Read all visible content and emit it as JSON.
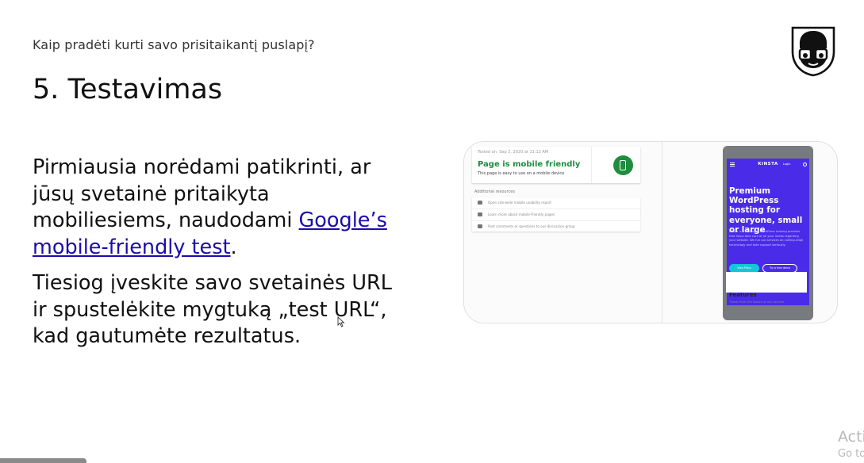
{
  "slide": {
    "subtitle": "Kaip pradėti kurti savo prisitaikantį puslapį?",
    "title": "5. Testavimas",
    "paragraph1_before_link": "Pirmiausia norėdami patikrinti, ar jūsų svetainė pritaikyta mobiliesiems, naudodami ",
    "link_text": "Google’s mobile-friendly test",
    "paragraph1_after_link": ".",
    "paragraph2": "Tiesiog įveskite savo svetainės URL ir spustelėkite mygtuką „test URL“, kad gautumėte rezultatus."
  },
  "screenshot": {
    "tested_on": "Tested on: Sep 2, 2020 at 11:12 AM",
    "result_title": "Page is mobile friendly",
    "result_desc": "This page is easy to use on a mobile device",
    "additional_resources": "Additional resources",
    "resources": [
      "Open site-wide mobile usability report",
      "Learn more about mobile-friendly pages",
      "Post comments or questions to our discussion group"
    ],
    "phone": {
      "brand": "KINSTA",
      "login": "Login",
      "hero": "Premium WordPress hosting for everyone, small or large",
      "para": "Kinsta is a managed WordPress hosting provider that helps take care of all your needs regarding your website. We run our services on cutting-edge technology and take support seriously.",
      "btn_primary": "View Plans",
      "btn_secondary": "Try a free demo",
      "features": "Features",
      "features_sub": "These from the basics of our service"
    }
  },
  "watermark": {
    "line1": "Acti",
    "line2": "Go to"
  },
  "icons": {
    "logo": "nerd-face-logo-icon",
    "result": "mobile-phone-icon",
    "cursor": "mouse-cursor-icon"
  },
  "colors": {
    "link": "#1a0dab",
    "success_green": "#1e8e3e",
    "kinsta_purple": "#4a2ce8",
    "accent_teal": "#14c7d6"
  }
}
